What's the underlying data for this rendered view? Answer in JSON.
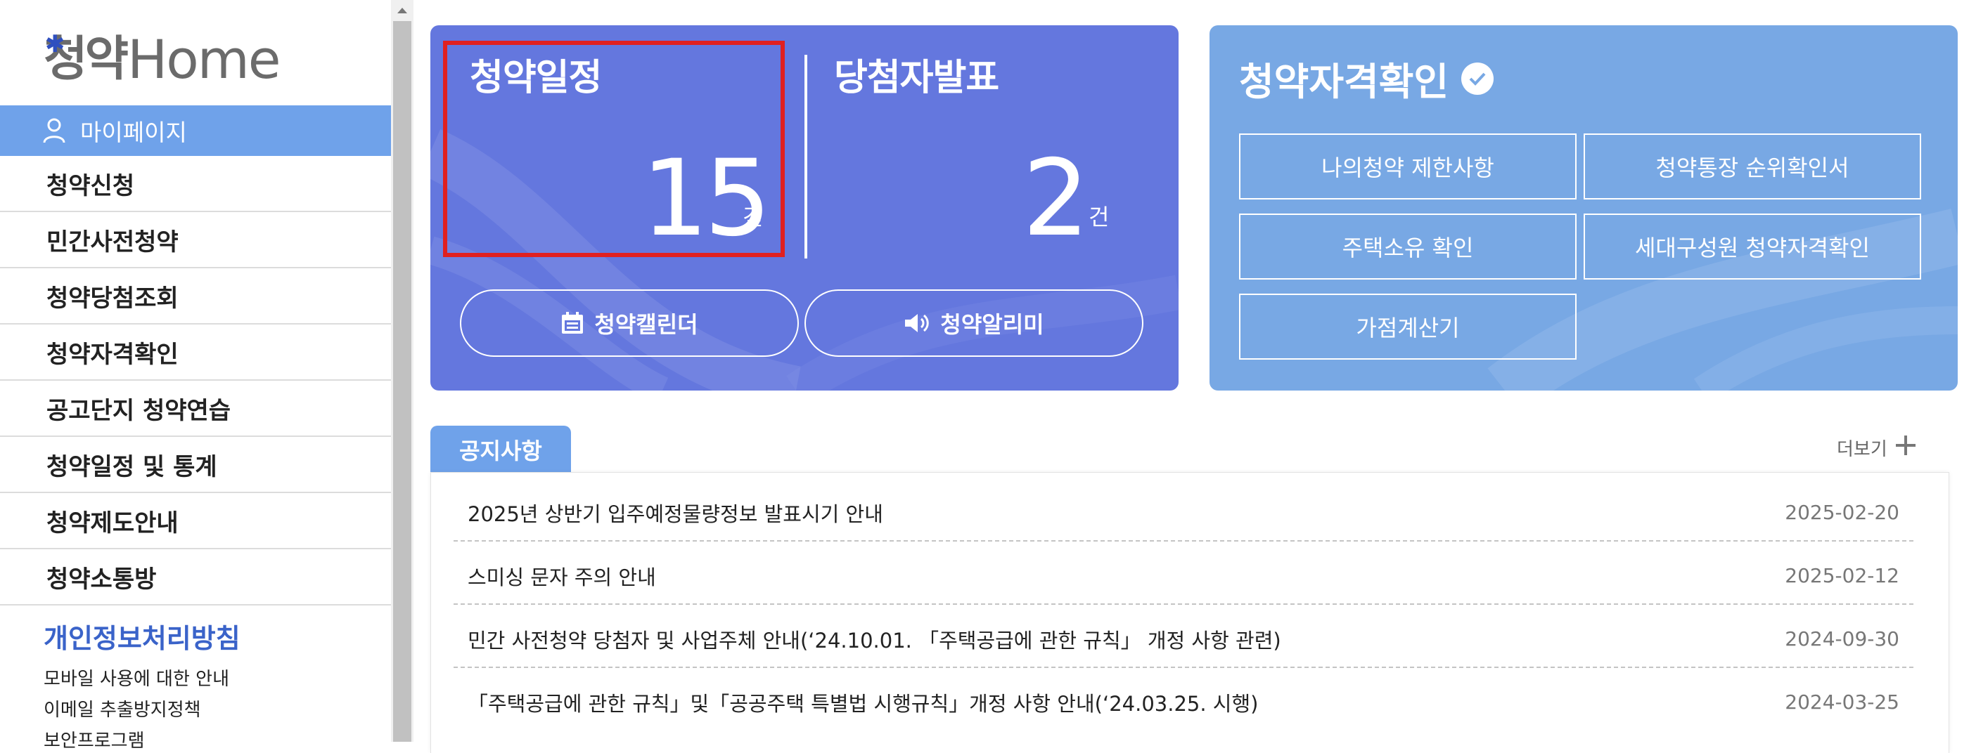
{
  "logo": {
    "text_kr": "청약",
    "text_en": "Home"
  },
  "sidebar": {
    "mypage_label": "마이페이지",
    "menu": [
      "청약신청",
      "민간사전청약",
      "청약당첨조회",
      "청약자격확인",
      "공고단지 청약연습",
      "청약일정 및 통계",
      "청약제도안내",
      "청약소통방"
    ],
    "privacy_label": "개인정보처리방침",
    "sublinks": [
      "모바일 사용에 대한 안내",
      "이메일 추출방지정책",
      "보안프로그램"
    ]
  },
  "schedule_card": {
    "schedule_title": "청약일정",
    "schedule_count": "15",
    "schedule_unit": "건",
    "winner_title": "당첨자발표",
    "winner_count": "2",
    "winner_unit": "건",
    "calendar_button": "청약캘린더",
    "alarm_button": "청약알리미"
  },
  "eligibility_card": {
    "title": "청약자격확인",
    "buttons": [
      "나의청약 제한사항",
      "청약통장 순위확인서",
      "주택소유 확인",
      "세대구성원 청약자격확인",
      "가점계산기"
    ]
  },
  "notices": {
    "tab_label": "공지사항",
    "more_label": "더보기",
    "items": [
      {
        "title": "2025년 상반기 입주예정물량정보 발표시기 안내",
        "date": "2025-02-20"
      },
      {
        "title": "스미싱 문자 주의 안내",
        "date": "2025-02-12"
      },
      {
        "title": "민간 사전청약 당첨자 및 사업주체 안내(‘24.10.01. 「주택공급에 관한 규칙」 개정 사항 관련)",
        "date": "2024-09-30"
      },
      {
        "title": "「주택공급에 관한 규칙」및「공공주택 특별법 시행규칙」개정 사항 안내(‘24.03.25. 시행)",
        "date": "2024-03-25"
      }
    ]
  },
  "colors": {
    "schedule_card_bg": "#6477de",
    "eligibility_card_bg": "#78a8e4",
    "accent_blue": "#6fa2ea",
    "highlight_red": "#e02020",
    "privacy_blue": "#3a63c9"
  },
  "icons": [
    "person-icon",
    "calendar-icon",
    "megaphone-icon",
    "check-circle-icon",
    "plus-icon",
    "scroll-up-arrow-icon"
  ]
}
